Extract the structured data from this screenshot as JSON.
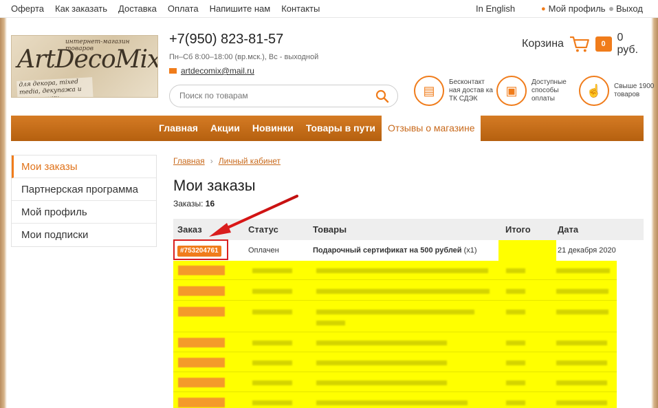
{
  "topbar": {
    "links": [
      "Оферта",
      "Как заказать",
      "Доставка",
      "Оплата",
      "Напишите нам",
      "Контакты"
    ],
    "lang": "In English",
    "profile": "Мой профиль",
    "logout": "Выход"
  },
  "header": {
    "logo_tag": "интернет-магазин товаров",
    "logo_brand": "ArtDecoMix",
    "logo_sub": "для декора, mixed media, декупажа и энкаустики",
    "phone": "+7(950) 823-81-57",
    "hours": "Пн–Сб 8:00–18:00 (вр.мск.), Вс - выходной",
    "email": "artdecomix@mail.ru",
    "search_placeholder": "Поиск по товарам",
    "cart_label": "Корзина",
    "cart_count": "0",
    "cart_total": "0 руб.",
    "features": [
      {
        "icon": "courier-icon",
        "text": "Бесконтакт ная достав ка ТК СДЭК"
      },
      {
        "icon": "card-icon",
        "text": "Доступные способы оплаты"
      },
      {
        "icon": "thumb-up-icon",
        "text": "Свыше 1900 товаров"
      }
    ]
  },
  "nav": [
    "Главная",
    "Акции",
    "Новинки",
    "Товары в пути",
    "Отзывы о магазине"
  ],
  "sidebar": [
    "Мои заказы",
    "Партнерская программа",
    "Мой профиль",
    "Мои подписки"
  ],
  "breadcrumb": {
    "home": "Главная",
    "cabinet": "Личный кабинет",
    "sep": "›"
  },
  "page": {
    "title": "Мои заказы",
    "count_label": "Заказы:",
    "count_value": "16"
  },
  "table": {
    "headers": [
      "Заказ",
      "Статус",
      "Товары",
      "Итого",
      "Дата"
    ],
    "first_row": {
      "order": "#753204761",
      "status": "Оплачен",
      "product": "Подарочный сертификат на 500 рублей",
      "qty": "(x1)",
      "date": "21 декабря 2020"
    }
  },
  "colors": {
    "accent": "#f07c1b",
    "highlight": "#ffff00",
    "annotation": "#d91e1e"
  }
}
